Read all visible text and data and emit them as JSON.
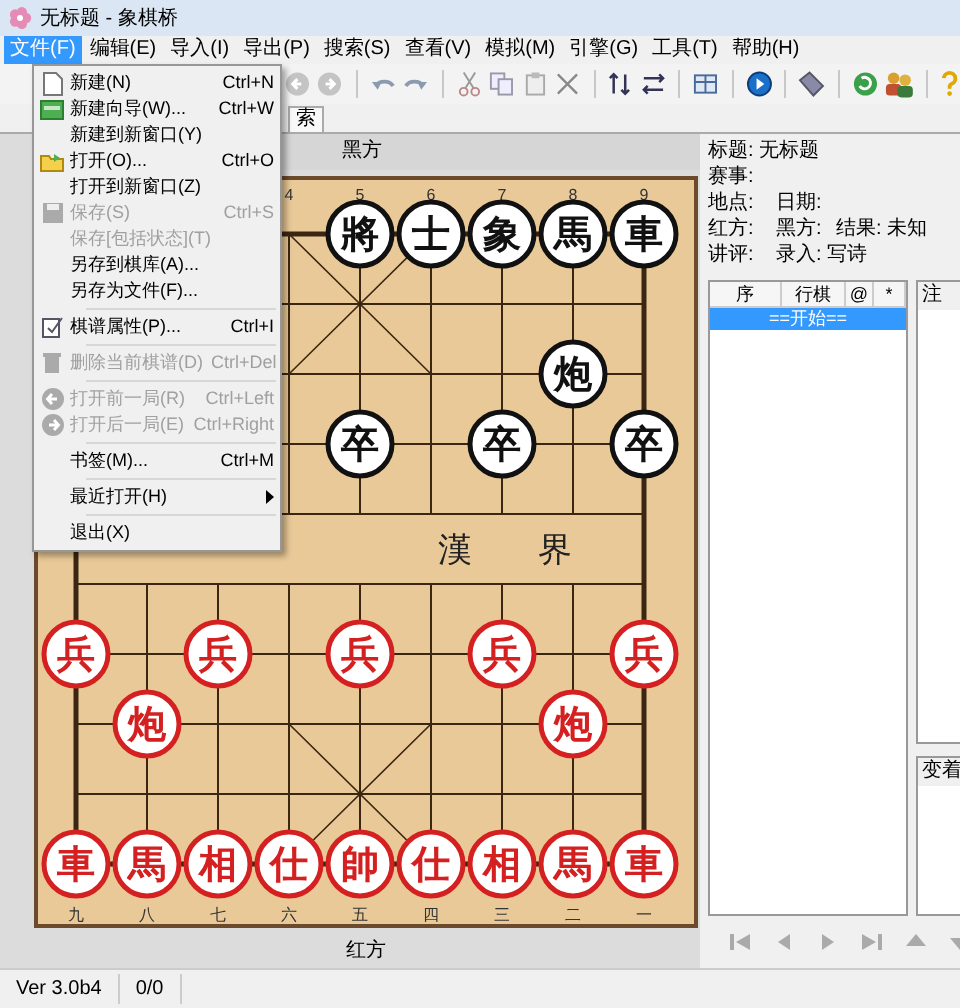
{
  "window": {
    "title": "无标题 - 象棋桥"
  },
  "menubar": [
    {
      "label": "文件(F)",
      "selected": true
    },
    {
      "label": "编辑(E)",
      "selected": false
    },
    {
      "label": "导入(I)",
      "selected": false
    },
    {
      "label": "导出(P)",
      "selected": false
    },
    {
      "label": "搜索(S)",
      "selected": false
    },
    {
      "label": "查看(V)",
      "selected": false
    },
    {
      "label": "模拟(M)",
      "selected": false
    },
    {
      "label": "引擎(G)",
      "selected": false
    },
    {
      "label": "工具(T)",
      "selected": false
    },
    {
      "label": "帮助(H)",
      "selected": false
    }
  ],
  "file_menu": [
    {
      "kind": "item",
      "label": "新建(N)",
      "shortcut": "Ctrl+N",
      "disabled": false
    },
    {
      "kind": "item",
      "label": "新建向导(W)...",
      "shortcut": "Ctrl+W",
      "disabled": false
    },
    {
      "kind": "item",
      "label": "新建到新窗口(Y)",
      "disabled": false
    },
    {
      "kind": "item",
      "label": "打开(O)...",
      "shortcut": "Ctrl+O",
      "disabled": false
    },
    {
      "kind": "item",
      "label": "打开到新窗口(Z)",
      "disabled": false
    },
    {
      "kind": "item",
      "label": "保存(S)",
      "shortcut": "Ctrl+S",
      "disabled": true
    },
    {
      "kind": "item",
      "label": "保存[包括状态](T)",
      "disabled": true
    },
    {
      "kind": "item",
      "label": "另存到棋库(A)...",
      "disabled": false
    },
    {
      "kind": "item",
      "label": "另存为文件(F)...",
      "disabled": false
    },
    {
      "kind": "separator"
    },
    {
      "kind": "item",
      "label": "棋谱属性(P)...",
      "shortcut": "Ctrl+I",
      "disabled": false
    },
    {
      "kind": "separator"
    },
    {
      "kind": "item",
      "label": "删除当前棋谱(D)",
      "shortcut": "Ctrl+Del",
      "disabled": true
    },
    {
      "kind": "separator"
    },
    {
      "kind": "item",
      "label": "打开前一局(R)",
      "shortcut": "Ctrl+Left",
      "disabled": true
    },
    {
      "kind": "item",
      "label": "打开后一局(E)",
      "shortcut": "Ctrl+Right",
      "disabled": true
    },
    {
      "kind": "separator"
    },
    {
      "kind": "item",
      "label": "书签(M)...",
      "shortcut": "Ctrl+M",
      "disabled": false
    },
    {
      "kind": "separator"
    },
    {
      "kind": "submenu",
      "label": "最近打开(H)",
      "disabled": false
    },
    {
      "kind": "separator"
    },
    {
      "kind": "item",
      "label": "退出(X)",
      "disabled": false
    }
  ],
  "tab": {
    "label": "索"
  },
  "board": {
    "top_side": "黑方",
    "bottom_side": "红方",
    "river": [
      "漢",
      "界"
    ],
    "top_labels": [
      "4",
      "5",
      "6",
      "7",
      "8",
      "9"
    ],
    "bottom_labels": [
      "九",
      "八",
      "七",
      "六",
      "五",
      "四",
      "三",
      "二",
      "一"
    ],
    "rows": [
      [
        null,
        null,
        null,
        null,
        {
          "kind": "black",
          "label": "將"
        },
        {
          "kind": "black",
          "label": "士"
        },
        {
          "kind": "black",
          "label": "象"
        },
        {
          "kind": "black",
          "label": "馬"
        },
        {
          "kind": "black",
          "label": "車"
        }
      ],
      [
        null,
        null,
        null,
        null,
        null,
        null,
        null,
        null,
        null
      ],
      [
        null,
        null,
        null,
        null,
        null,
        null,
        null,
        {
          "kind": "black",
          "label": "炮"
        },
        null
      ],
      [
        null,
        null,
        null,
        null,
        {
          "kind": "black",
          "label": "卒"
        },
        null,
        {
          "kind": "black",
          "label": "卒"
        },
        null,
        {
          "kind": "black",
          "label": "卒"
        }
      ],
      [
        null,
        null,
        null,
        null,
        null,
        null,
        null,
        null,
        null
      ],
      [
        null,
        null,
        null,
        null,
        null,
        null,
        null,
        null,
        null
      ],
      [
        {
          "kind": "red",
          "label": "兵"
        },
        null,
        {
          "kind": "red",
          "label": "兵"
        },
        null,
        {
          "kind": "red",
          "label": "兵"
        },
        null,
        {
          "kind": "red",
          "label": "兵"
        },
        null,
        {
          "kind": "red",
          "label": "兵"
        }
      ],
      [
        null,
        {
          "kind": "red",
          "label": "炮"
        },
        null,
        null,
        null,
        null,
        null,
        {
          "kind": "red",
          "label": "炮"
        },
        null
      ],
      [
        null,
        null,
        null,
        null,
        null,
        null,
        null,
        null,
        null
      ],
      [
        {
          "kind": "red",
          "label": "車"
        },
        {
          "kind": "red",
          "label": "馬"
        },
        {
          "kind": "red",
          "label": "相"
        },
        {
          "kind": "red",
          "label": "仕"
        },
        {
          "kind": "red",
          "label": "帥"
        },
        {
          "kind": "red",
          "label": "仕"
        },
        {
          "kind": "red",
          "label": "相"
        },
        {
          "kind": "red",
          "label": "馬"
        },
        {
          "kind": "red",
          "label": "車"
        }
      ]
    ]
  },
  "info": [
    [
      {
        "label": "标题:",
        "value": "无标题"
      }
    ],
    [
      {
        "label": "赛事:"
      }
    ],
    [
      {
        "label": "地点:"
      },
      {
        "label": "日期:"
      }
    ],
    [
      {
        "label": "红方:"
      },
      {
        "label": "黑方:"
      },
      {
        "label": "结果:",
        "value": "未知"
      }
    ],
    [
      {
        "label": "讲评:"
      },
      {
        "label": "录入:",
        "value": "写诗"
      }
    ]
  ],
  "moves": {
    "columns": [
      "序",
      "行棋",
      "@",
      "*"
    ],
    "rows": [
      {
        "text": "==开始==",
        "selected": true
      }
    ]
  },
  "annotation": {
    "label": "注"
  },
  "variations": {
    "label": "变着"
  },
  "status_bar": [
    "Ver 3.0b4",
    "0/0"
  ]
}
